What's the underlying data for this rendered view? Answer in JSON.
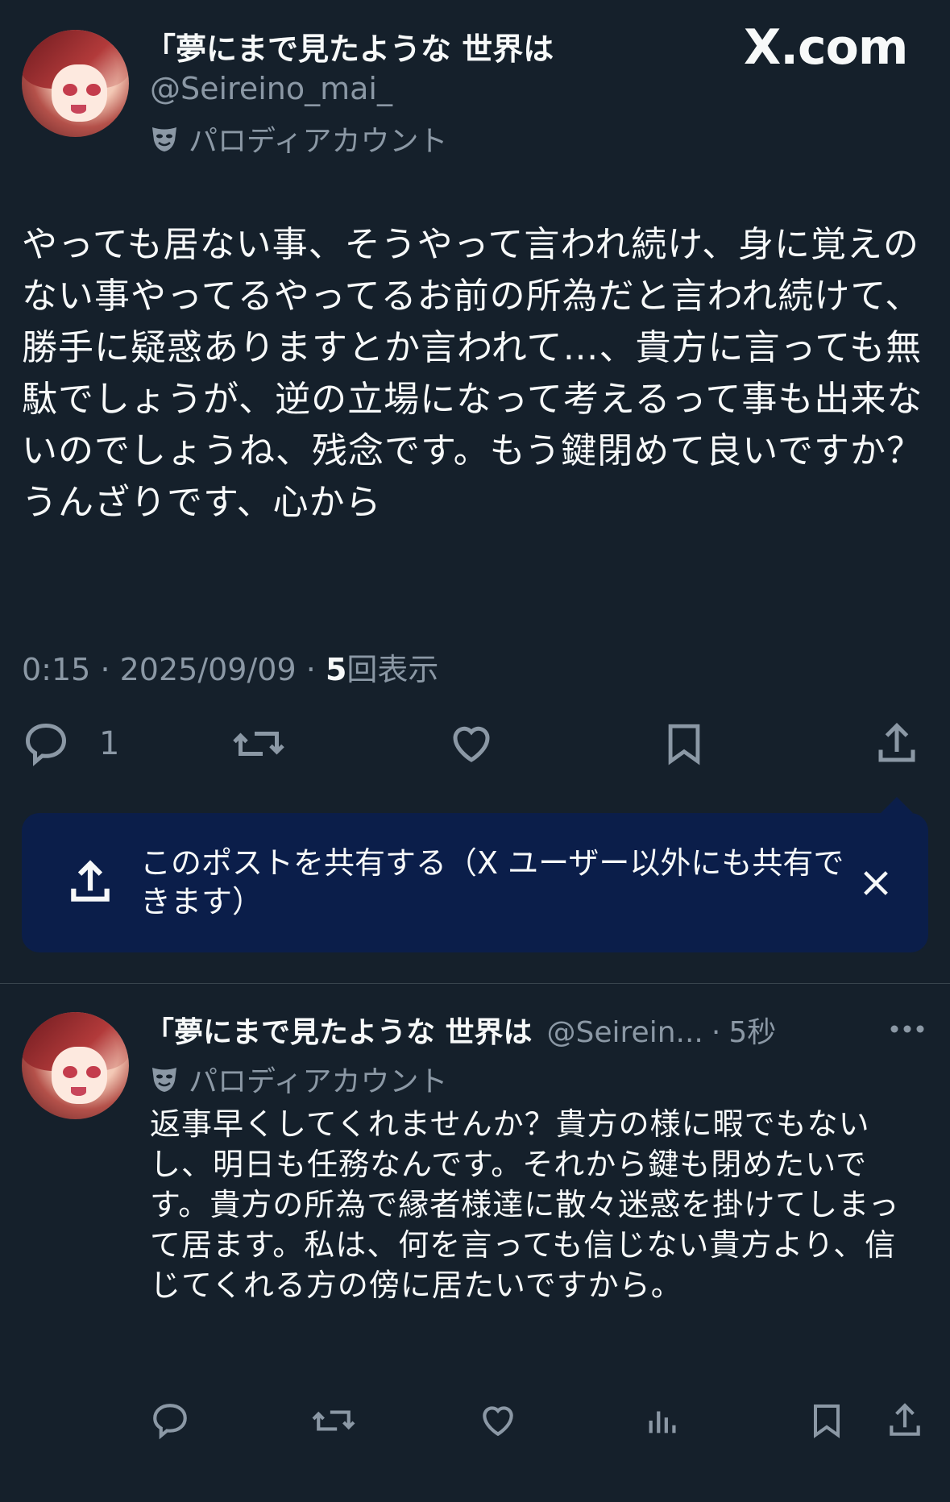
{
  "main_post": {
    "display_name": "「夢にまで見たような 世界は",
    "handle": "@Seireino_mai_",
    "parody_label": "パロディアカウント",
    "text": "やっても居ない事、そうやって言われ続け、身に覚えのない事やってるやってるお前の所為だと言われ続けて、勝手に疑惑ありますとか言われて…、貴方に言っても無駄でしょうが、逆の立場になって考えるって事も出来ないのでしょうね、残念です。もう鍵閉めて良いですか？うんざりです、心から",
    "time": "0:15",
    "separator": "·",
    "date": "2025/09/09",
    "views_count": "5",
    "views_label": "回表示",
    "reply_count": "1"
  },
  "brand": {
    "logo_text": "X.com"
  },
  "share_toast": {
    "text": "このポストを共有する（X ユーザー以外にも共有できます）"
  },
  "reply_post": {
    "display_name": "「夢にまで見たような 世界は",
    "handle": "@Seirein...",
    "separator": "·",
    "time_ago": "5秒",
    "parody_label": "パロディアカウント",
    "text": "返事早くしてくれませんか？貴方の様に暇でもないし、明日も任務なんです。それから鍵も閉めたいです。貴方の所為で縁者様達に散々迷惑を掛けてしまって居ます。私は、何を言っても信じない貴方より、信じてくれる方の傍に居たいですから。"
  },
  "colors": {
    "background": "#15202b",
    "text_primary": "#f7f9f9",
    "text_secondary": "#8b98a5",
    "toast_bg": "#0b1e4a"
  }
}
